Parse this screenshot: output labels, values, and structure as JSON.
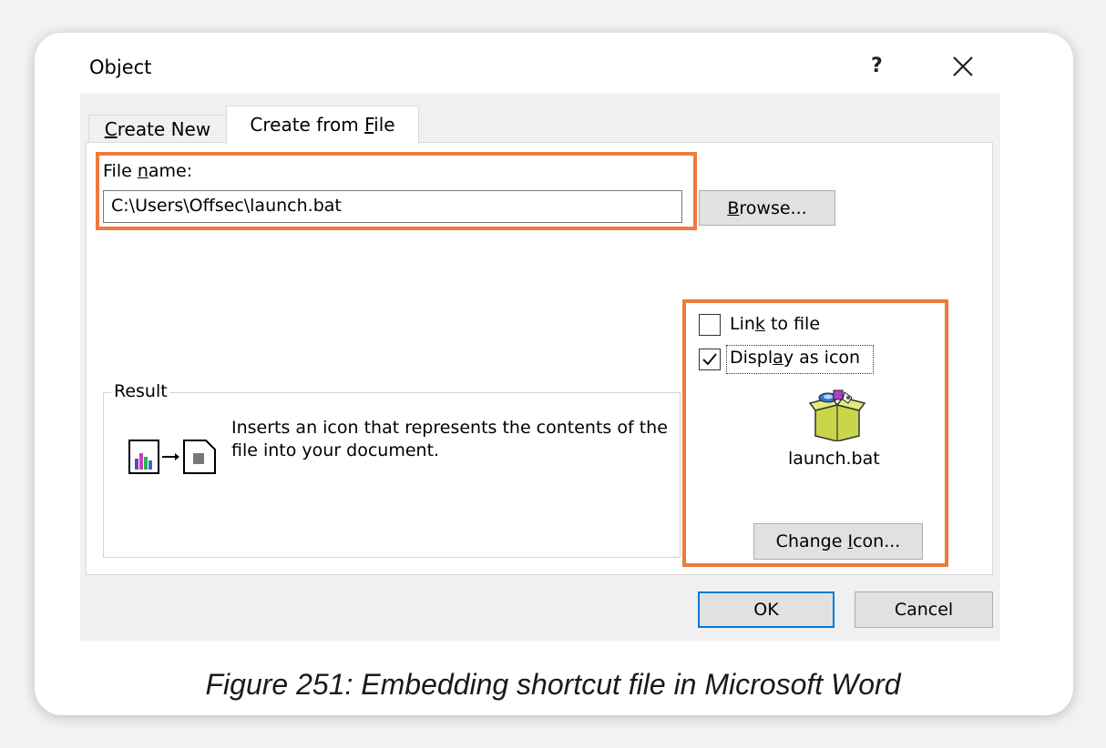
{
  "dialog": {
    "title": "Object",
    "help": "?",
    "tabs": {
      "create_new": {
        "pre": "",
        "mnemonic": "C",
        "post": "reate New"
      },
      "create_from_file": {
        "pre": "Create from ",
        "mnemonic": "F",
        "post": "ile"
      }
    },
    "file_name_label": {
      "pre": "File ",
      "mnemonic": "n",
      "post": "ame:"
    },
    "file_name_value": "C:\\Users\\Offsec\\launch.bat",
    "browse_button": {
      "pre": "",
      "mnemonic": "B",
      "post": "rowse..."
    },
    "link_to_file": {
      "pre": "Lin",
      "mnemonic": "k",
      "post": " to file",
      "checked": false
    },
    "display_as_icon": {
      "pre": "Displ",
      "mnemonic": "a",
      "post": "y as icon",
      "checked": true
    },
    "icon_caption": "launch.bat",
    "change_icon_button": {
      "pre": "Change ",
      "mnemonic": "I",
      "post": "con..."
    },
    "result": {
      "title": "Result",
      "text": "Inserts an icon that represents the contents of the file into your document."
    },
    "ok_button": "OK",
    "cancel_button": "Cancel"
  },
  "caption": "Figure 251: Embedding shortcut file in Microsoft Word",
  "colors": {
    "highlight": "#f07a3c",
    "ok_border": "#0078d7"
  }
}
